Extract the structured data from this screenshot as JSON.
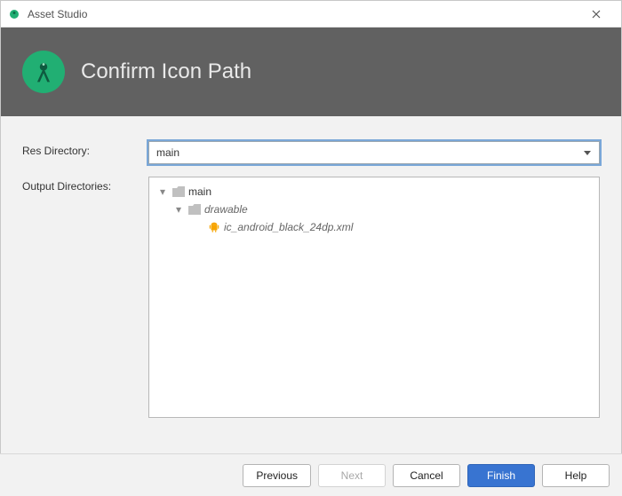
{
  "window": {
    "title": "Asset Studio"
  },
  "header": {
    "title": "Confirm Icon Path"
  },
  "form": {
    "res_directory_label": "Res Directory:",
    "res_directory_value": "main",
    "output_directories_label": "Output Directories:"
  },
  "tree": {
    "root": {
      "label": "main",
      "expanded": true
    },
    "drawable": {
      "label": "drawable",
      "expanded": true
    },
    "file": {
      "label": "ic_android_black_24dp.xml"
    }
  },
  "buttons": {
    "previous": "Previous",
    "next": "Next",
    "cancel": "Cancel",
    "finish": "Finish",
    "help": "Help"
  }
}
